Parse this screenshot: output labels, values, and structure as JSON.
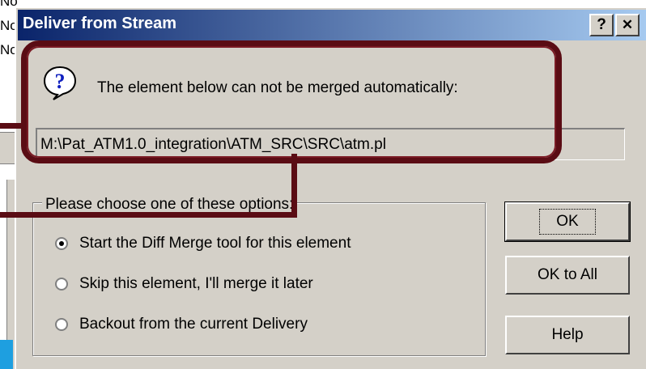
{
  "background": {
    "list_items": [
      "No",
      "No",
      "No"
    ]
  },
  "dialog": {
    "title": "Deliver from Stream",
    "help_caption": "?",
    "close_caption": "✕",
    "icon": "question-balloon-icon",
    "message": "The element below can not be merged automatically:",
    "path": "M:\\Pat_ATM1.0_integration\\ATM_SRC\\SRC\\atm.pl",
    "options_label": "Please choose one of these options:",
    "options": [
      {
        "label": "Start the Diff Merge tool for this element",
        "selected": true
      },
      {
        "label": "Skip this element, I'll merge it later",
        "selected": false
      },
      {
        "label": "Backout from the current Delivery",
        "selected": false
      }
    ],
    "buttons": {
      "ok": "OK",
      "ok_all": "OK to All",
      "help": "Help"
    }
  },
  "colors": {
    "titlebar_start": "#0a246a",
    "titlebar_end": "#a6caf0",
    "callout": "#5a0c14",
    "face": "#d4d0c8"
  }
}
